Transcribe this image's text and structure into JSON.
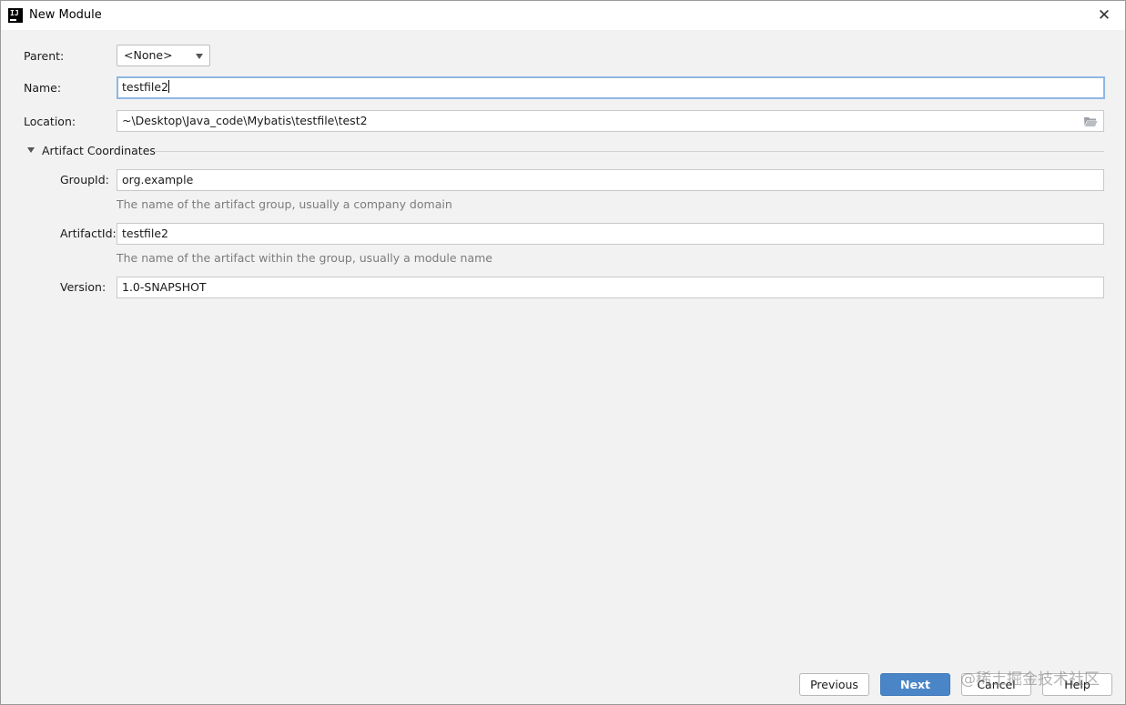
{
  "window": {
    "title": "New Module",
    "app_icon_text": "IJ"
  },
  "form": {
    "parent": {
      "label": "Parent:",
      "value": "<None>"
    },
    "name": {
      "label": "Name:",
      "value": "testfile2"
    },
    "location": {
      "label": "Location:",
      "value": "~\\Desktop\\Java_code\\Mybatis\\testfile\\test2"
    }
  },
  "artifact": {
    "section_title": "Artifact Coordinates",
    "group_id": {
      "label": "GroupId:",
      "value": "org.example",
      "hint": "The name of the artifact group, usually a company domain"
    },
    "artifact_id": {
      "label": "ArtifactId:",
      "value": "testfile2",
      "hint": "The name of the artifact within the group, usually a module name"
    },
    "version": {
      "label": "Version:",
      "value": "1.0-SNAPSHOT"
    }
  },
  "buttons": {
    "previous": "Previous",
    "next": "Next",
    "cancel": "Cancel",
    "help": "Help"
  },
  "watermark": "@稀土掘金技术社区",
  "colors": {
    "primary_button": "#4a86c7",
    "focus_border": "#8fb7e3",
    "dialog_background": "#f2f2f2"
  }
}
